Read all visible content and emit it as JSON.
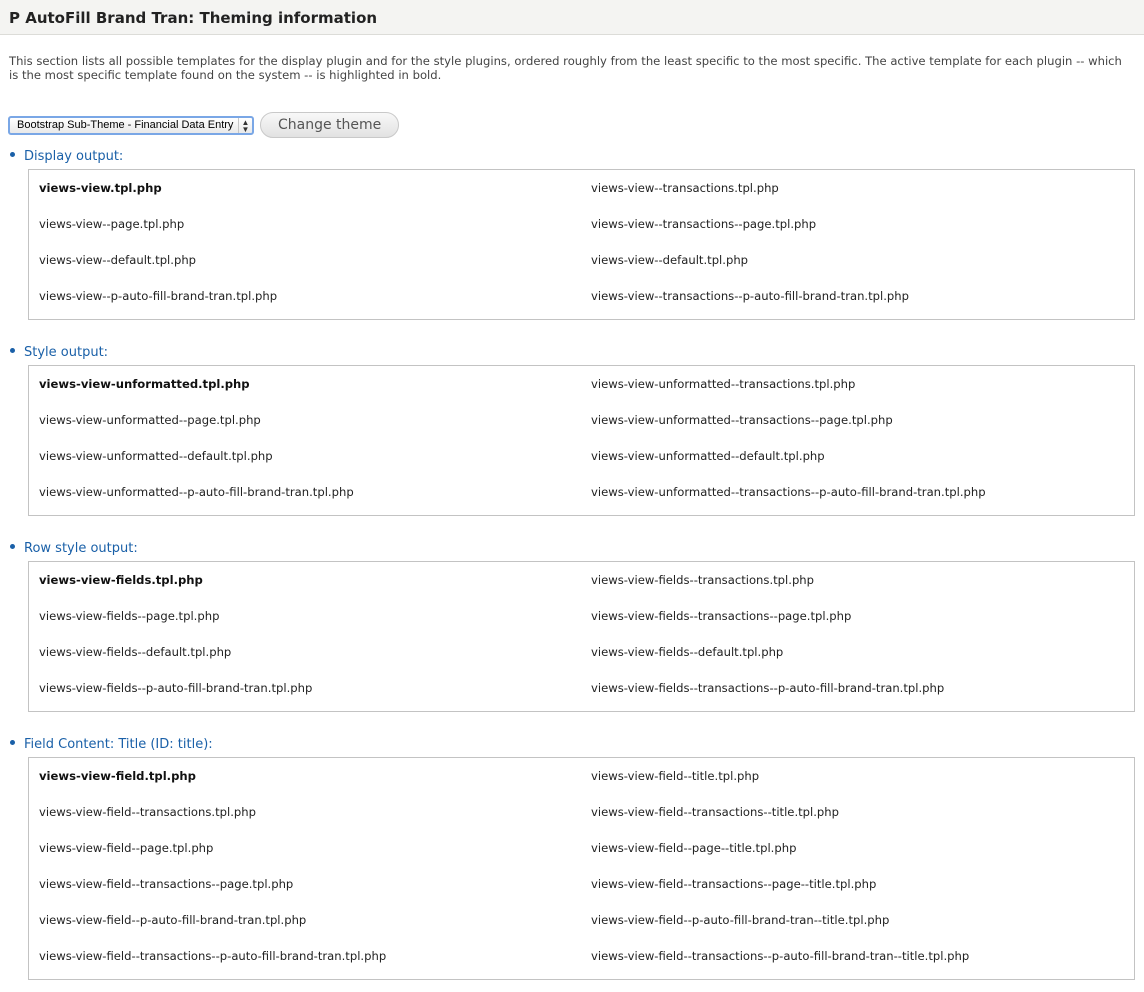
{
  "page": {
    "title": "P AutoFill Brand Tran: Theming information",
    "description": "This section lists all possible templates for the display plugin and for the style plugins, ordered roughly from the least specific to the most specific. The active template for each plugin -- which is the most specific template found on the system -- is highlighted in bold."
  },
  "controls": {
    "theme_select_value": "Bootstrap Sub-Theme - Financial Data Entry",
    "change_button_label": "Change theme"
  },
  "sections": [
    {
      "heading": "Display output:",
      "rows": [
        [
          "views-view.tpl.php",
          "views-view--transactions.tpl.php"
        ],
        [
          "views-view--page.tpl.php",
          "views-view--transactions--page.tpl.php"
        ],
        [
          "views-view--default.tpl.php",
          "views-view--default.tpl.php"
        ],
        [
          "views-view--p-auto-fill-brand-tran.tpl.php",
          "views-view--transactions--p-auto-fill-brand-tran.tpl.php"
        ]
      ]
    },
    {
      "heading": "Style output:",
      "rows": [
        [
          "views-view-unformatted.tpl.php",
          "views-view-unformatted--transactions.tpl.php"
        ],
        [
          "views-view-unformatted--page.tpl.php",
          "views-view-unformatted--transactions--page.tpl.php"
        ],
        [
          "views-view-unformatted--default.tpl.php",
          "views-view-unformatted--default.tpl.php"
        ],
        [
          "views-view-unformatted--p-auto-fill-brand-tran.tpl.php",
          "views-view-unformatted--transactions--p-auto-fill-brand-tran.tpl.php"
        ]
      ]
    },
    {
      "heading": "Row style output:",
      "rows": [
        [
          "views-view-fields.tpl.php",
          "views-view-fields--transactions.tpl.php"
        ],
        [
          "views-view-fields--page.tpl.php",
          "views-view-fields--transactions--page.tpl.php"
        ],
        [
          "views-view-fields--default.tpl.php",
          "views-view-fields--default.tpl.php"
        ],
        [
          "views-view-fields--p-auto-fill-brand-tran.tpl.php",
          "views-view-fields--transactions--p-auto-fill-brand-tran.tpl.php"
        ]
      ]
    },
    {
      "heading": "Field Content: Title (ID: title):",
      "rows": [
        [
          "views-view-field.tpl.php",
          "views-view-field--title.tpl.php"
        ],
        [
          "views-view-field--transactions.tpl.php",
          "views-view-field--transactions--title.tpl.php"
        ],
        [
          "views-view-field--page.tpl.php",
          "views-view-field--page--title.tpl.php"
        ],
        [
          "views-view-field--transactions--page.tpl.php",
          "views-view-field--transactions--page--title.tpl.php"
        ],
        [
          "views-view-field--p-auto-fill-brand-tran.tpl.php",
          "views-view-field--p-auto-fill-brand-tran--title.tpl.php"
        ],
        [
          "views-view-field--transactions--p-auto-fill-brand-tran.tpl.php",
          "views-view-field--transactions--p-auto-fill-brand-tran--title.tpl.php"
        ]
      ]
    }
  ]
}
